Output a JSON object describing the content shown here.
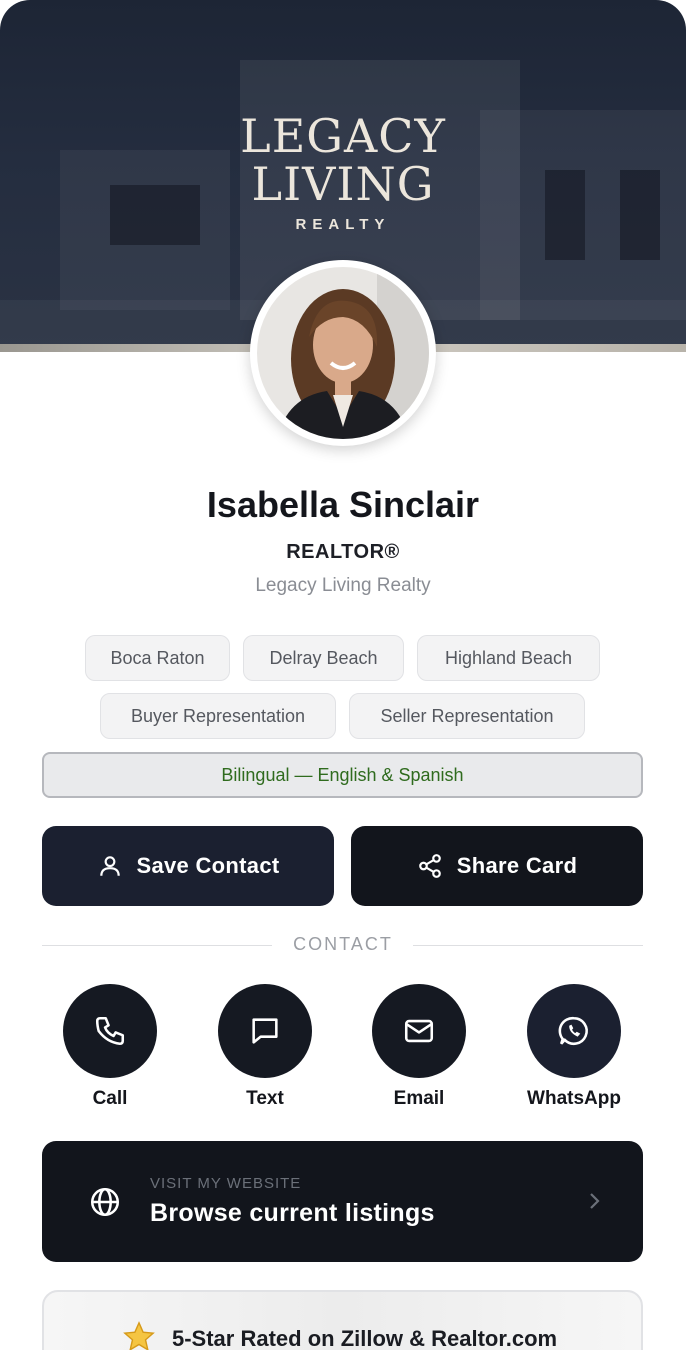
{
  "brand": {
    "line1": "LEGACY",
    "line2": "LIVING",
    "line3": "REALTY"
  },
  "profile": {
    "name": "Isabella Sinclair",
    "title": "REALTOR®",
    "company": "Legacy Living Realty"
  },
  "tags": [
    "Boca Raton",
    "Delray Beach",
    "Highland Beach",
    "Buyer Representation",
    "Seller Representation"
  ],
  "language": "Bilingual — English & Spanish",
  "actions": {
    "save_label": "Save Contact",
    "share_label": "Share Card"
  },
  "contact": {
    "section_label": "CONTACT",
    "items": [
      {
        "label": "Call",
        "icon": "phone-icon"
      },
      {
        "label": "Text",
        "icon": "message-icon"
      },
      {
        "label": "Email",
        "icon": "mail-icon"
      },
      {
        "label": "WhatsApp",
        "icon": "whatsapp-icon"
      }
    ]
  },
  "website": {
    "eyebrow": "VISIT MY WEBSITE",
    "label": "Browse current listings",
    "icon": "globe-icon"
  },
  "rating": {
    "label": "5-Star Rated on Zillow & Realtor.com",
    "icon": "star-icon"
  },
  "colors": {
    "hero": "#242d3f",
    "button_dark": "#12151c",
    "button_navy": "#1b2030",
    "language_text": "#2f6b1e"
  }
}
